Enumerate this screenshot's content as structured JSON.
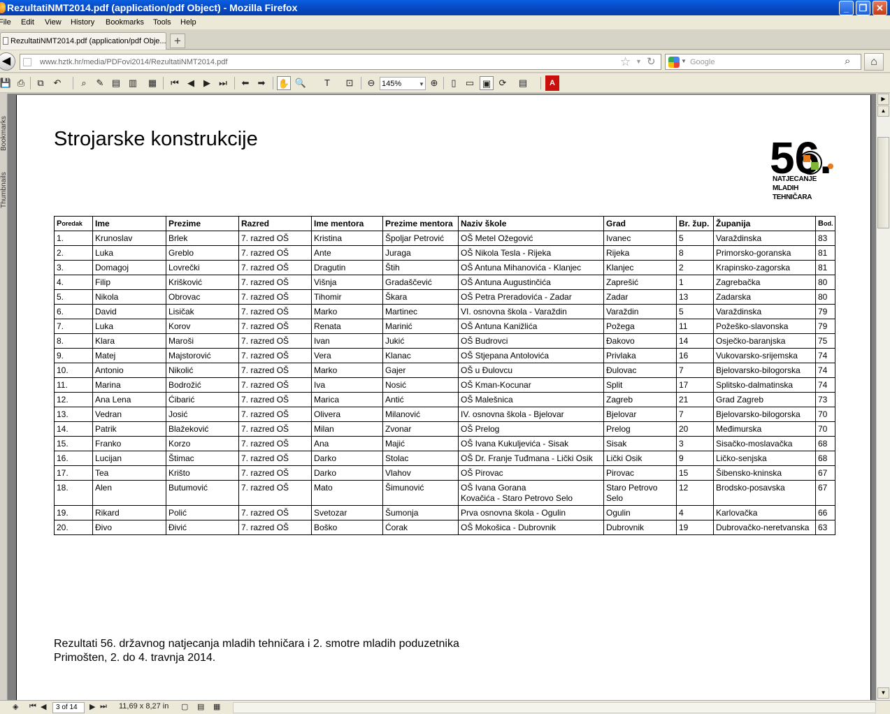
{
  "window": {
    "title": "RezultatiNMT2014.pdf (application/pdf Object) - Mozilla Firefox"
  },
  "menu": [
    "File",
    "Edit",
    "View",
    "History",
    "Bookmarks",
    "Tools",
    "Help"
  ],
  "tab": {
    "label": "RezultatiNMT2014.pdf (application/pdf Obje..."
  },
  "nav": {
    "url": "www.hztk.hr/media/PDFovi2014/RezultatiNMT2014.pdf",
    "search_placeholder": "Google"
  },
  "pdf_toolbar": {
    "zoom": "145%"
  },
  "sidebar": {
    "bookmarks_label": "Bookmarks",
    "thumbnails_label": "Thumbnails"
  },
  "document": {
    "title": "Strojarske konstrukcije",
    "logo": {
      "number": "56.",
      "lines": [
        "NATJECANJE",
        "MLADIH",
        "TEHNIČARA"
      ]
    },
    "table": {
      "headers": {
        "poredak_p": "P",
        "poredak_rest": "oredak",
        "ime": "Ime",
        "prezime": "Prezime",
        "razred": "Razred",
        "ime_mentora": "Ime mentora",
        "prezime_mentora": "Prezime mentora",
        "naziv_skole": "Naziv škole",
        "grad": "Grad",
        "br_zup": "Br. žup.",
        "zupanija": "Županija",
        "bod_b": "B",
        "bod_rest": "od."
      },
      "rows": [
        [
          "1.",
          "Krunoslav",
          "Brlek",
          "7. razred OŠ",
          "Kristina",
          "Špoljar Petrović",
          "OŠ Metel Ožegović",
          "Ivanec",
          "5",
          "Varaždinska",
          "83"
        ],
        [
          "2.",
          "Luka",
          "Greblo",
          "7. razred OŠ",
          "Ante",
          "Juraga",
          "OŠ Nikola Tesla - Rijeka",
          "Rijeka",
          "8",
          "Primorsko-goranska",
          "81"
        ],
        [
          "3.",
          "Domagoj",
          "Lovrečki",
          "7. razred OŠ",
          "Dragutin",
          "Štih",
          "OŠ Antuna Mihanovića - Klanjec",
          "Klanjec",
          "2",
          "Krapinsko-zagorska",
          "81"
        ],
        [
          "4.",
          "Filip",
          "Krišković",
          "7. razred OŠ",
          "Višnja",
          "Gradaščević",
          "OŠ Antuna Augustinčića",
          "Zaprešić",
          "1",
          "Zagrebačka",
          "80"
        ],
        [
          "5.",
          "Nikola",
          "Obrovac",
          "7. razred OŠ",
          "Tihomir",
          "Škara",
          "OŠ Petra Preradovića - Zadar",
          "Zadar",
          "13",
          "Zadarska",
          "80"
        ],
        [
          "6.",
          "David",
          "Lisičak",
          "7. razred OŠ",
          "Marko",
          "Martinec",
          "VI. osnovna škola - Varaždin",
          "Varaždin",
          "5",
          "Varaždinska",
          "79"
        ],
        [
          "7.",
          "Luka",
          "Korov",
          "7. razred OŠ",
          "Renata",
          "Marinić",
          "OŠ Antuna Kanižlića",
          "Požega",
          "11",
          "Požeško-slavonska",
          "79"
        ],
        [
          "8.",
          "Klara",
          "Maroši",
          "7. razred OŠ",
          "Ivan",
          "Jukić",
          "OŠ Budrovci",
          "Đakovo",
          "14",
          "Osječko-baranjska",
          "75"
        ],
        [
          "9.",
          "Matej",
          "Majstorović",
          "7. razred OŠ",
          "Vera",
          "Klanac",
          "OŠ Stjepana Antolovića",
          "Privlaka",
          "16",
          "Vukovarsko-srijemska",
          "74"
        ],
        [
          "10.",
          "Antonio",
          "Nikolić",
          "7. razred OŠ",
          "Marko",
          "Gajer",
          "OŠ u Đulovcu",
          "Đulovac",
          "7",
          "Bjelovarsko-bilogorska",
          "74"
        ],
        [
          "11.",
          "Marina",
          "Bodrožić",
          "7. razred OŠ",
          "Iva",
          "Nosić",
          "OŠ Kman-Kocunar",
          "Split",
          "17",
          "Splitsko-dalmatinska",
          "74"
        ],
        [
          "12.",
          "Ana Lena",
          "Ćibarić",
          "7. razred OŠ",
          "Marica",
          "Antić",
          "OŠ Malešnica",
          "Zagreb",
          "21",
          "Grad Zagreb",
          "73"
        ],
        [
          "13.",
          "Vedran",
          "Josić",
          "7. razred OŠ",
          "Olivera",
          "Milanović",
          "IV. osnovna škola - Bjelovar",
          "Bjelovar",
          "7",
          "Bjelovarsko-bilogorska",
          "70"
        ],
        [
          "14.",
          "Patrik",
          "Blažeković",
          "7. razred OŠ",
          "Milan",
          "Zvonar",
          "OŠ Prelog",
          "Prelog",
          "20",
          "Međimurska",
          "70"
        ],
        [
          "15.",
          "Franko",
          "Korzo",
          "7. razred OŠ",
          "Ana",
          "Majić",
          "OŠ Ivana Kukuljevića - Sisak",
          "Sisak",
          "3",
          "Sisačko-moslavačka",
          "68"
        ],
        [
          "16.",
          "Lucijan",
          "Štimac",
          "7. razred OŠ",
          "Darko",
          "Stolac",
          "OŠ Dr. Franje Tuđmana - Lički Osik",
          "Lički Osik",
          "9",
          "Ličko-senjska",
          "68"
        ],
        [
          "17.",
          "Tea",
          "Krišto",
          "7. razred OŠ",
          "Darko",
          "Vlahov",
          "OŠ Pirovac",
          "Pirovac",
          "15",
          "Šibensko-kninska",
          "67"
        ],
        [
          "18.",
          "Alen",
          "Butumović",
          "7. razred OŠ",
          "Mato",
          "Šimunović",
          "OŠ Ivana Gorana\nKovačića - Staro Petrovo Selo",
          "Staro Petrovo\nSelo",
          "12",
          "Brodsko-posavska",
          "67"
        ],
        [
          "19.",
          "Rikard",
          "Polić",
          "7. razred OŠ",
          "Svetozar",
          "Šumonja",
          "Prva osnovna škola - Ogulin",
          "Ogulin",
          "4",
          "Karlovačka",
          "66"
        ],
        [
          "20.",
          "Đivo",
          "Đivić",
          "7. razred OŠ",
          "Boško",
          "Ćorak",
          "OŠ Mokošica - Dubrovnik",
          "Dubrovnik",
          "19",
          "Dubrovačko-neretvanska",
          "63"
        ]
      ]
    },
    "footer": {
      "line1": "Rezultati 56. državnog natjecanja mladih tehničara i 2. smotre mladih poduzetnika",
      "line2": "Primošten, 2. do 4. travnja 2014."
    }
  },
  "status": {
    "page": "3 of 14",
    "page_size": "11,69 x 8,27 in"
  }
}
